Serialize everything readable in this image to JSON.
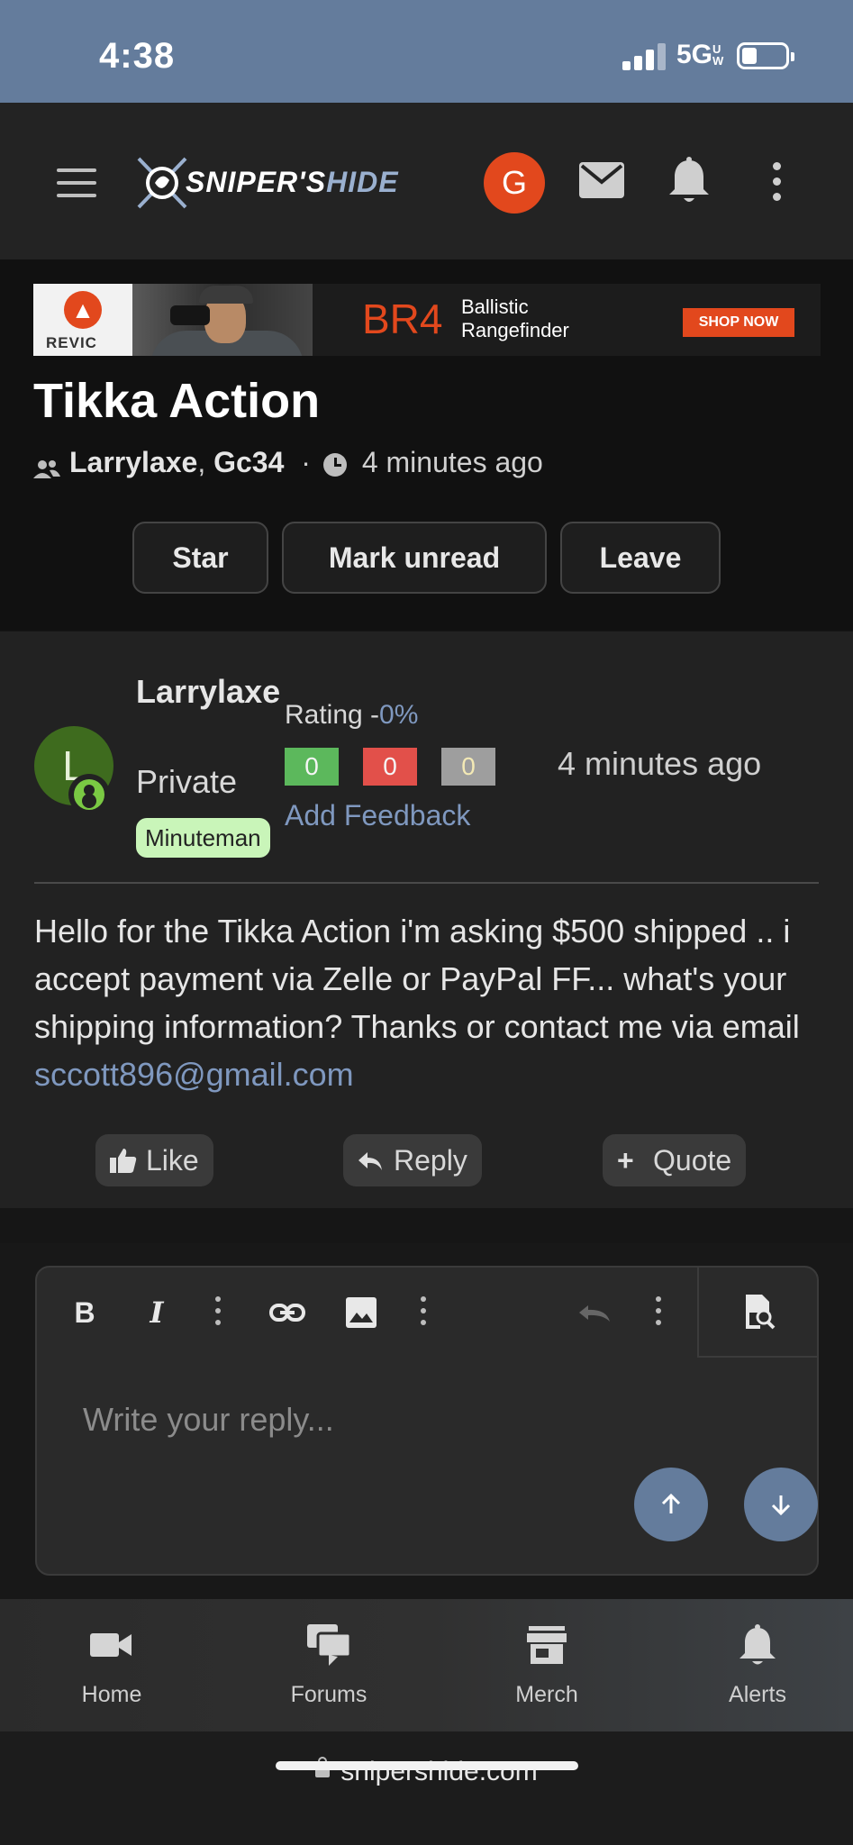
{
  "status_bar": {
    "time": "4:38",
    "network": "5G",
    "network_sub": "UW"
  },
  "header": {
    "logo_main": "SNIPER'S",
    "logo_accent": "HIDE",
    "user_initial": "G"
  },
  "ad": {
    "brand": "REVIC",
    "product": "BR4",
    "tagline_1": "Ballistic",
    "tagline_2": "Rangefinder",
    "cta": "SHOP NOW"
  },
  "thread": {
    "title": "Tikka Action",
    "participant_1": "Larrylaxe",
    "participant_sep": ", ",
    "participant_2": "Gc34",
    "meta_sep": "·",
    "time": "4 minutes ago",
    "buttons": {
      "star": "Star",
      "mark_unread": "Mark unread",
      "leave": "Leave"
    }
  },
  "message": {
    "avatar_initial": "L",
    "author": "Larrylaxe",
    "rank": "Private",
    "tag": "Minuteman",
    "rating_label": "Rating -",
    "rating_pct": "0%",
    "feedback": {
      "positive": "0",
      "negative": "0",
      "neutral": "0"
    },
    "add_feedback": "Add Feedback",
    "time": "4 minutes ago",
    "body": "Hello for the Tikka Action i'm asking $500 shipped .. i accept payment via Zelle or PayPal FF... what's your shipping information? Thanks or contact me via email ",
    "email": "sccott896@gmail.com",
    "actions": {
      "like": "Like",
      "reply": "Reply",
      "quote": "Quote"
    }
  },
  "editor": {
    "placeholder": "Write your reply..."
  },
  "bottom_nav": {
    "items": [
      {
        "label": "Home"
      },
      {
        "label": "Forums"
      },
      {
        "label": "Merch"
      },
      {
        "label": "Alerts"
      }
    ]
  },
  "browser": {
    "url": "snipershide.com"
  },
  "colors": {
    "accent": "#647c9c",
    "brand_orange": "#e2481d",
    "link": "#7f98bf",
    "positive": "#5cb85c",
    "negative": "#e2504a",
    "neutral": "#9e9e9e",
    "tag_bg": "#c9f5b9"
  }
}
